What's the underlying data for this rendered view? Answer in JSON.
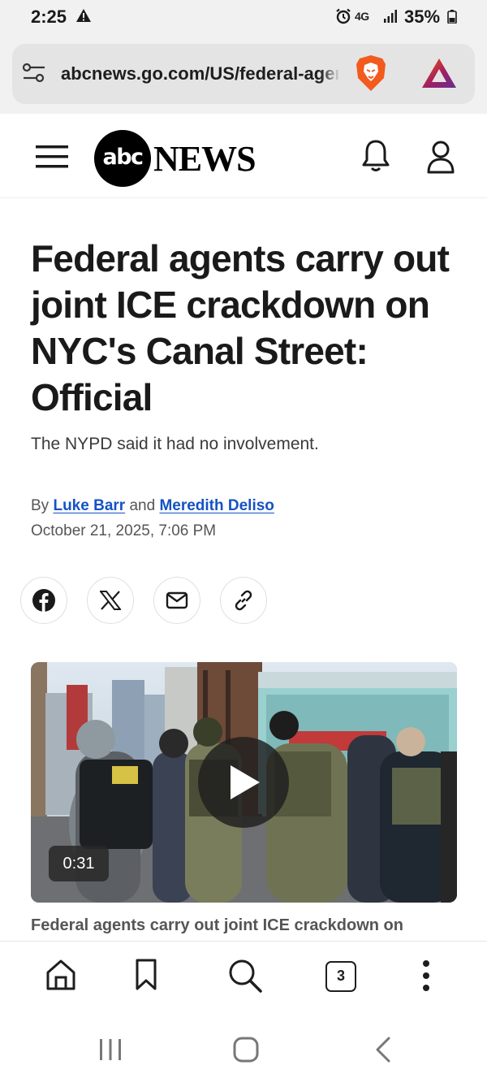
{
  "status_bar": {
    "time": "2:25",
    "network": "4G",
    "battery": "35%"
  },
  "browser": {
    "url": "abcnews.go.com/US/federal-agents",
    "tab_count": "3"
  },
  "site": {
    "logo_badge": "abc",
    "logo_text": "NEWS"
  },
  "article": {
    "headline": "Federal agents carry out joint ICE crackdown on NYC's Canal Street: Official",
    "dek": "The NYPD said it had no involvement.",
    "byline_prefix": "By",
    "author_1": "Luke Barr",
    "byline_and": "and",
    "author_2": "Meredith Deliso",
    "date": "October 21, 2025, 7:06 PM"
  },
  "video": {
    "duration": "0:31",
    "caption": "Federal agents carry out joint ICE crackdown on"
  },
  "colors": {
    "link": "#1552c4",
    "brave_orange": "#f25a1e"
  }
}
